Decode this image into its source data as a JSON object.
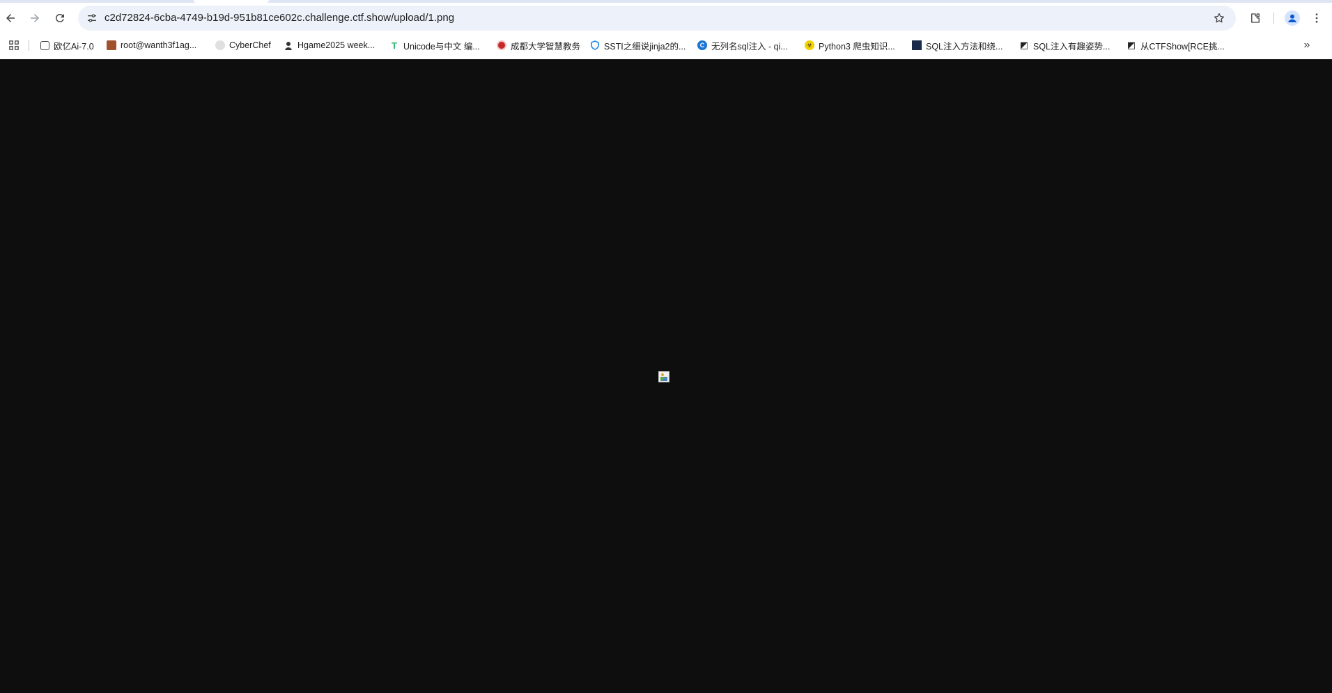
{
  "browser": {
    "url": "c2d72824-6cba-4749-b19d-951b81ce602c.challenge.ctf.show/upload/1.png"
  },
  "bookmarks": [
    {
      "label": "欧亿Ai-7.0",
      "icon": "chat-bubble-icon",
      "color": "#444444"
    },
    {
      "label": "root@wanth3f1ag...",
      "icon": "avatar-icon",
      "color": "#a0522d"
    },
    {
      "label": "CyberChef",
      "icon": "chef-hat-icon",
      "color": "#9e9e9e"
    },
    {
      "label": "Hgame2025 week...",
      "icon": "person-icon",
      "color": "#333333"
    },
    {
      "label": "Unicode与中文 编...",
      "icon": "t-logo-icon",
      "color": "#2bb673"
    },
    {
      "label": "成都大学智慧教务",
      "icon": "university-seal-icon",
      "color": "#c62828"
    },
    {
      "label": "SSTI之细说jinja2的...",
      "icon": "shield-icon",
      "color": "#1e88e5"
    },
    {
      "label": "无列名sql注入 - qi...",
      "icon": "c-logo-icon",
      "color": "#1976d2"
    },
    {
      "label": "Python3 爬虫知识...",
      "icon": "biohazard-icon",
      "color": "#c9b800"
    },
    {
      "label": "SQL注入方法和绕...",
      "icon": "site-thumbnail-icon",
      "color": "#1a2a4a"
    },
    {
      "label": "SQL注入有趣姿势...",
      "icon": "slash-logo-icon",
      "color": "#222222"
    },
    {
      "label": "从CTFShow[RCE挑...",
      "icon": "slash-logo-icon",
      "color": "#222222"
    }
  ],
  "content": {
    "image_alt": ""
  }
}
